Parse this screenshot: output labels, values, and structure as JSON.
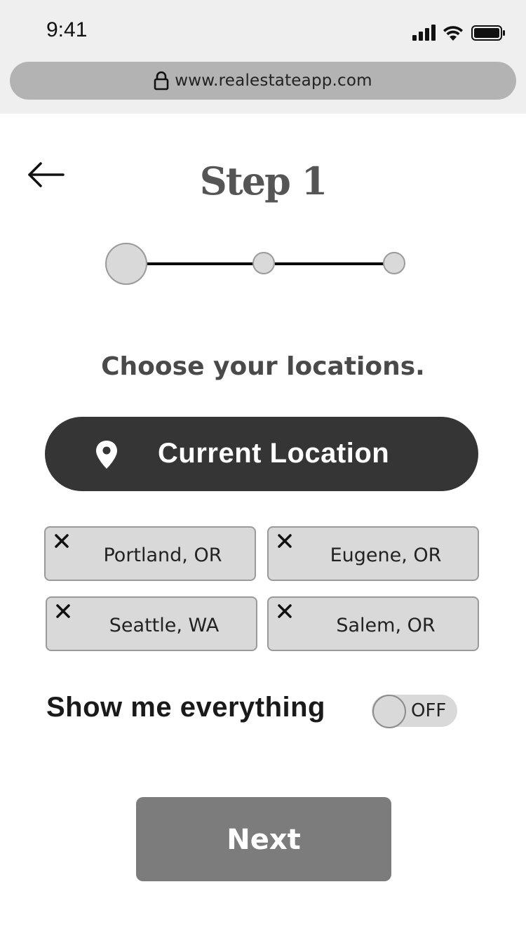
{
  "status_bar": {
    "time": "9:41",
    "icons": [
      "cellular-signal-icon",
      "wifi-icon",
      "battery-icon"
    ]
  },
  "browser": {
    "url": "www.realestateapp.com",
    "lock_icon": "lock-icon"
  },
  "header": {
    "back_icon": "arrow-left-icon",
    "title": "Step 1"
  },
  "progress": {
    "total_steps": 3,
    "current_step": 1
  },
  "prompt": "Choose your locations.",
  "current_location_button": {
    "icon": "map-pin-icon",
    "label": "Current Location"
  },
  "locations": [
    {
      "label": "Portland, OR"
    },
    {
      "label": "Eugene, OR"
    },
    {
      "label": "Seattle, WA"
    },
    {
      "label": "Salem, OR"
    }
  ],
  "show_everything": {
    "label": "Show me everything",
    "toggle_state": "OFF"
  },
  "next_button": {
    "label": "Next"
  },
  "colors": {
    "chrome_bg": "#efefef",
    "url_bar": "#b3b3b3",
    "dark_button": "#353535",
    "chip_bg": "#d9d9d9",
    "next_button": "#7c7c7c",
    "title_text": "#555555"
  }
}
